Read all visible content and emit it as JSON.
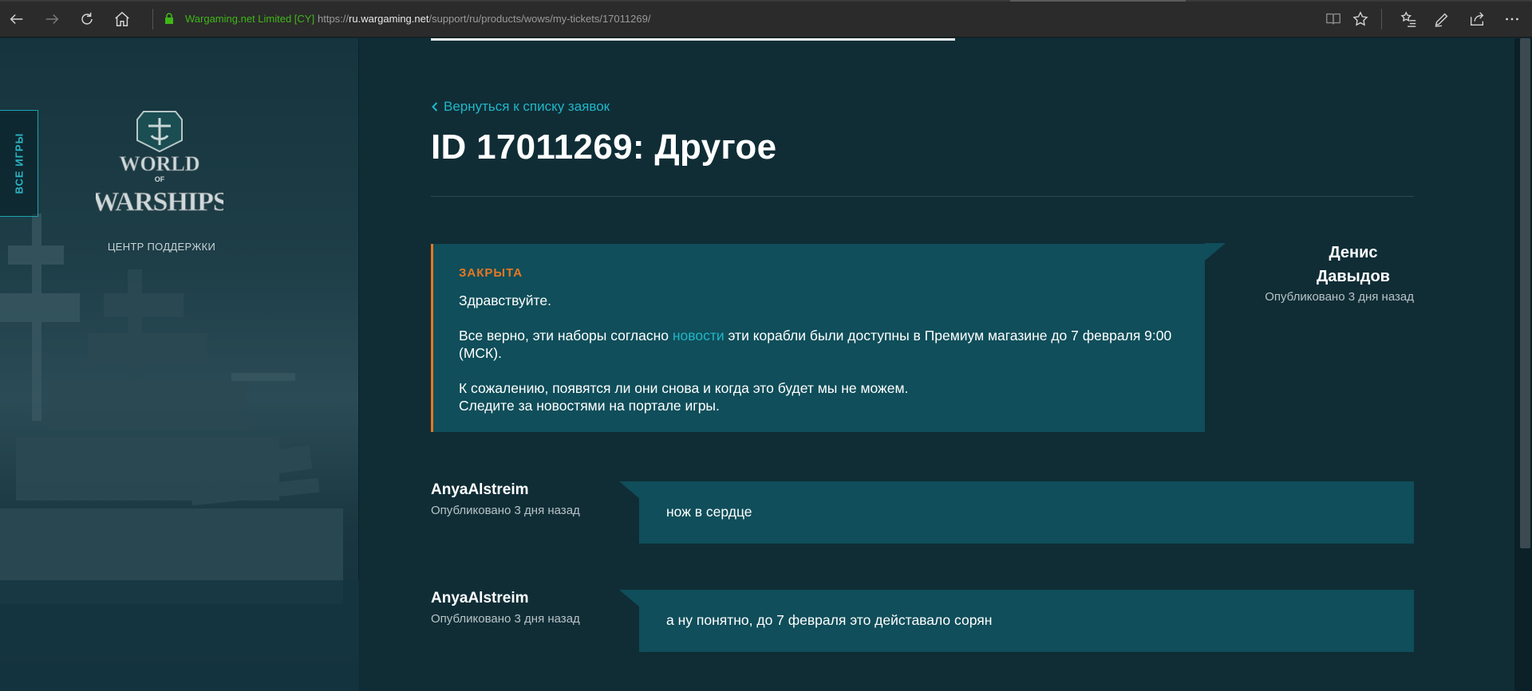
{
  "browser": {
    "cert_label": "Wargaming.net Limited [CY]",
    "url_prefix": "https://",
    "url_host": "ru.wargaming.net",
    "url_path": "/support/ru/products/wows/my-tickets/17011269/"
  },
  "sidebar": {
    "all_games_label": "ВСЕ ИГРЫ",
    "logo_line1": "WORLD",
    "logo_line2": "OF",
    "logo_line3": "WARSHIPS",
    "support_center_label": "ЦЕНТР ПОДДЕРЖКИ"
  },
  "ticket": {
    "back_link": "Вернуться к списку заявок",
    "title": "ID 17011269: Другое"
  },
  "support_message": {
    "status": "ЗАКРЫТА",
    "greeting": "Здравствуйте.",
    "p1_before": "Все верно, эти наборы согласно ",
    "p1_link": "новости",
    "p1_after": " эти корабли были доступны в Премиум магазине до 7 февраля 9:00 (МСК).",
    "p2_line1": "К сожалению, появятся ли они снова и когда это будет мы не можем.",
    "p2_line2": "Следите за новостями на портале игры.",
    "author_first": "Денис",
    "author_last": "Давыдов",
    "published": "Опубликовано 3 дня назад"
  },
  "replies": [
    {
      "author": "AnyaAlstreim",
      "published": "Опубликовано 3 дня назад",
      "text": "нож в сердце"
    },
    {
      "author": "AnyaAlstreim",
      "published": "Опубликовано 3 дня назад",
      "text": "а ну понятно, до 7 февраля это дейставало сорян"
    }
  ],
  "colors": {
    "accent_cyan": "#21b6c7",
    "status_orange": "#e87722",
    "message_bg": "#0f4e5a",
    "page_bg": "#0f2c35",
    "cert_green": "#3fb618"
  },
  "icons": {
    "back": "back-arrow-icon",
    "forward": "forward-arrow-icon",
    "refresh": "refresh-icon",
    "home": "home-icon",
    "reading_view": "reading-view-icon",
    "favorite": "star-icon",
    "favorites_hub": "favorites-list-icon",
    "notes": "pen-icon",
    "share": "share-icon",
    "more": "more-icon"
  }
}
